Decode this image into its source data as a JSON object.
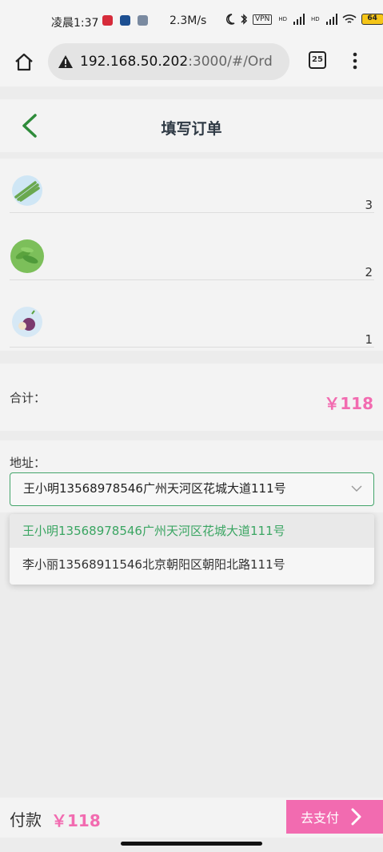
{
  "status_bar": {
    "time": "凌晨1:37",
    "speed": "2.3M/s",
    "vpn": "VPN",
    "hd1": "HD",
    "hd2": "HD",
    "battery": "64"
  },
  "browser": {
    "url_host": "192.168.50.202",
    "url_rest": ":3000/#/Ord",
    "tab_count": "25"
  },
  "header": {
    "title": "填写订单"
  },
  "items": [
    {
      "name": "asparagus",
      "qty": "3",
      "thumb_color": "#cfe6f5",
      "icon_color": "#6aa84f"
    },
    {
      "name": "edamame",
      "qty": "2",
      "thumb_color": "#7cbf5a",
      "icon_color": "#4f9a3a"
    },
    {
      "name": "onion",
      "qty": "1",
      "thumb_color": "#d6e8f5",
      "icon_color": "#7b3a6e"
    }
  ],
  "total": {
    "label": "合计：",
    "value": "￥118"
  },
  "address": {
    "label": "地址：",
    "selected": "王小明13568978546广州天河区花城大道111号",
    "options": [
      "王小明13568978546广州天河区花城大道111号",
      "李小丽13568911546北京朝阳区朝阳北路111号"
    ]
  },
  "pay": {
    "label": "付款",
    "amount": "￥118",
    "button": "去支付"
  },
  "colors": {
    "accent_pink": "#f26bb0",
    "accent_green": "#3aa562"
  }
}
